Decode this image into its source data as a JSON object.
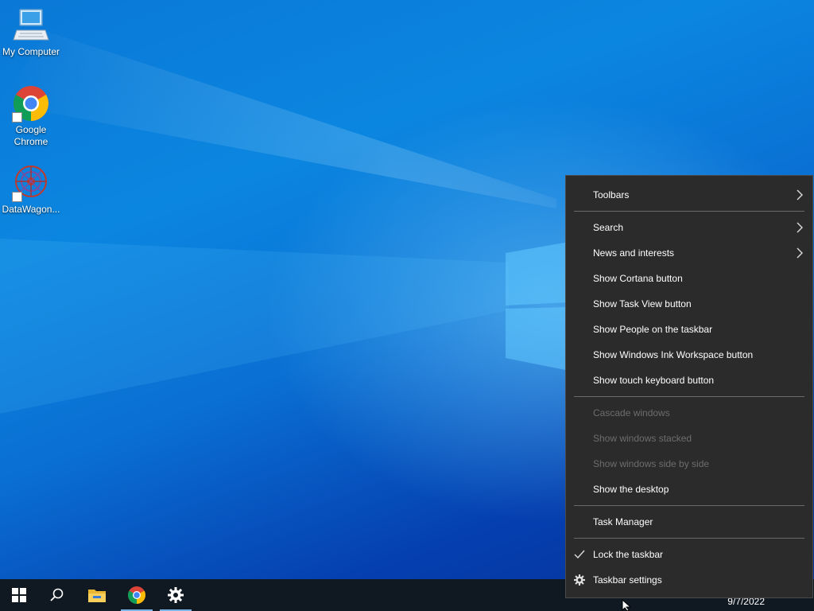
{
  "desktop": {
    "icons": [
      {
        "label": "My Computer",
        "icon": "computer-icon"
      },
      {
        "label": "Google Chrome",
        "icon": "chrome-icon"
      },
      {
        "label": "DataWagon...",
        "icon": "datawagon-icon"
      }
    ]
  },
  "taskbar": {
    "buttons": [
      {
        "icon": "windows-start-icon"
      },
      {
        "icon": "search-icon"
      },
      {
        "icon": "file-explorer-icon"
      },
      {
        "icon": "chrome-icon"
      },
      {
        "icon": "settings-gear-icon"
      }
    ],
    "date": "9/7/2022"
  },
  "context_menu": {
    "items": [
      {
        "label": "Toolbars",
        "submenu": true,
        "enabled": true
      },
      {
        "label": "Search",
        "submenu": true,
        "enabled": true
      },
      {
        "label": "News and interests",
        "submenu": true,
        "enabled": true
      },
      {
        "label": "Show Cortana button",
        "enabled": true
      },
      {
        "label": "Show Task View button",
        "enabled": true
      },
      {
        "label": "Show People on the taskbar",
        "enabled": true
      },
      {
        "label": "Show Windows Ink Workspace button",
        "enabled": true
      },
      {
        "label": "Show touch keyboard button",
        "enabled": true
      },
      {
        "label": "Cascade windows",
        "enabled": false
      },
      {
        "label": "Show windows stacked",
        "enabled": false
      },
      {
        "label": "Show windows side by side",
        "enabled": false
      },
      {
        "label": "Show the desktop",
        "enabled": true
      },
      {
        "label": "Task Manager",
        "enabled": true
      },
      {
        "label": "Lock the taskbar",
        "enabled": true,
        "checked": true
      },
      {
        "label": "Taskbar settings",
        "enabled": true,
        "icon": "gear-icon"
      }
    ]
  },
  "colors": {
    "menu_bg": "#2b2b2b",
    "menu_disabled_text": "#6d6d6d",
    "taskbar_bg": "#101822",
    "active_indicator": "#7ab4e6"
  }
}
